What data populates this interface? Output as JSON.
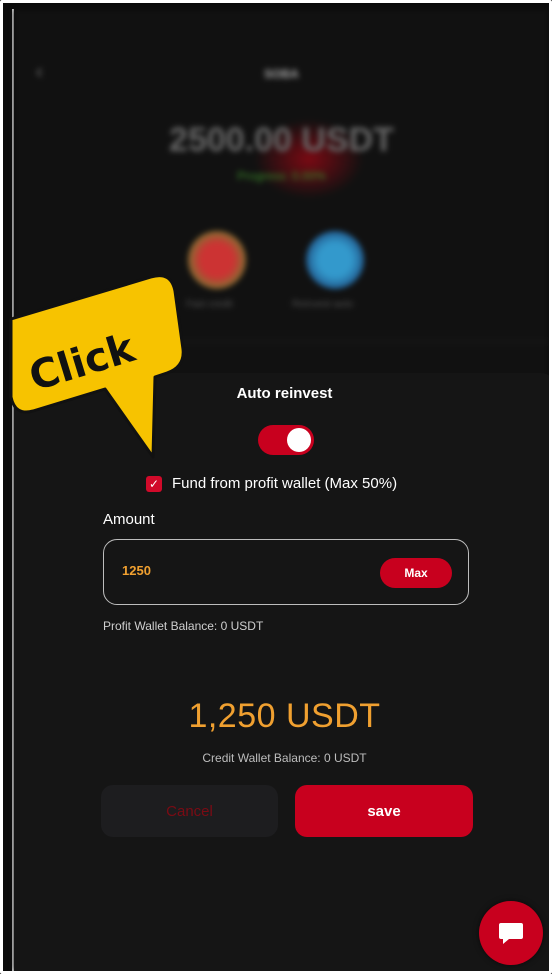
{
  "background": {
    "title": "SOBA",
    "amount": "2500.00 USDT",
    "progress": "Progress: 0.00%",
    "action1": "Fast credit",
    "action2": "Reinvest auto"
  },
  "modal": {
    "title": "Auto reinvest",
    "auto_reinvest_enabled": true,
    "fund_checkbox_checked": true,
    "fund_label": "Fund from profit wallet (Max 50%)",
    "amount_label": "Amount",
    "amount_value": "1250",
    "max_label": "Max",
    "profit_wallet_balance": "Profit Wallet Balance: 0 USDT",
    "total_amount": "1,250 USDT",
    "credit_wallet_balance": "Credit Wallet Balance: 0 USDT",
    "cancel_label": "Cancel",
    "save_label": "save"
  },
  "callout": {
    "text": "Click"
  },
  "colors": {
    "accent_red": "#c8001e",
    "amount_orange": "#f0a030",
    "callout_yellow": "#f7c300"
  },
  "icons": {
    "back": "chevron-left-icon",
    "chat": "chat-bubble-icon",
    "check": "checkmark-icon"
  }
}
